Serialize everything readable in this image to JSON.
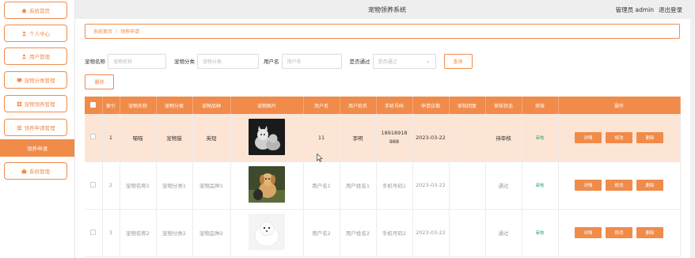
{
  "app": {
    "title": "宠物领养系统"
  },
  "header": {
    "user_label": "管理员 admin",
    "logout": "退出登录"
  },
  "sidebar": {
    "items": [
      {
        "label": "系统首页",
        "icon": "home-icon"
      },
      {
        "label": "个人中心",
        "icon": "person-icon"
      },
      {
        "label": "用户管理",
        "icon": "person-icon"
      },
      {
        "label": "宠物分类管理",
        "icon": "monitor-icon"
      },
      {
        "label": "宠物领养管理",
        "icon": "grid-icon"
      },
      {
        "label": "领养申请管理",
        "icon": "list-icon"
      },
      {
        "label": "领养申请",
        "active": true
      },
      {
        "label": "系统管理",
        "icon": "briefcase-icon"
      }
    ]
  },
  "breadcrumb": {
    "home": "系统首页",
    "current": "领养申请"
  },
  "search": {
    "name_label": "宠物名称",
    "name_placeholder": "宠物名称",
    "category_label": "宠物分类",
    "category_placeholder": "宠物分类",
    "user_label": "用户名",
    "user_placeholder": "用户名",
    "pass_label": "是否通过",
    "pass_placeholder": "是否通过",
    "query_button": "查询"
  },
  "actions": {
    "delete_button": "删除"
  },
  "table": {
    "headers": [
      "",
      "索引",
      "宠物名称",
      "宠物分类",
      "宠物品种",
      "宠物图片",
      "用户名",
      "用户姓名",
      "手机号码",
      "申请日期",
      "审核回复",
      "审核状态",
      "审核",
      "操作"
    ],
    "rows": [
      {
        "index": "1",
        "name": "喵喵",
        "category": "宠物猫",
        "breed": "英短",
        "image": "cat-photo",
        "username": "11",
        "realname": "李明",
        "phone": "18918918988",
        "date": "2023-03-22",
        "reply": "",
        "status": "待审核",
        "audit": "审核"
      },
      {
        "index": "2",
        "name": "宠物名称1",
        "category": "宠物分类1",
        "breed": "宠物品种1",
        "image": "dog-photo",
        "username": "用户名1",
        "realname": "用户姓名1",
        "phone": "手机号码1",
        "date": "2023-03-22",
        "reply": "",
        "status": "通过",
        "audit": "审核"
      },
      {
        "index": "3",
        "name": "宠物名称2",
        "category": "宠物分类2",
        "breed": "宠物品种2",
        "image": "pomeranian-photo",
        "username": "用户名2",
        "realname": "用户姓名2",
        "phone": "手机号码2",
        "date": "2023-03-22",
        "reply": "",
        "status": "通过",
        "audit": "审核"
      }
    ],
    "ops": {
      "detail": "详情",
      "edit": "修改",
      "delete": "删除"
    }
  },
  "colors": {
    "accent": "#f08b4a",
    "highlight_row": "#fde5d6",
    "audit_link": "#2aa86a"
  }
}
